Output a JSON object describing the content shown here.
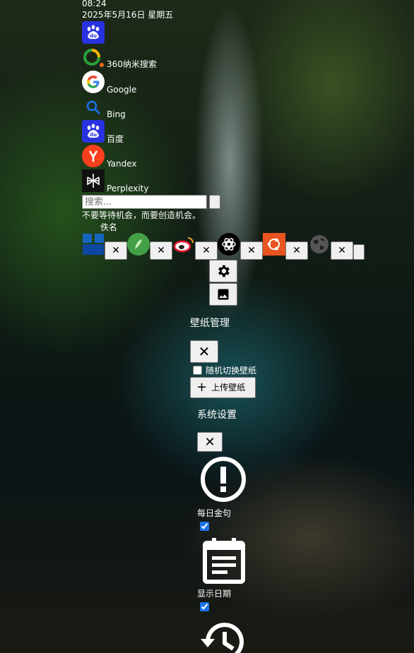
{
  "header": {
    "time": "08:24",
    "date": "2025年5月16日 星期五"
  },
  "engines": [
    {
      "label": ""
    },
    {
      "label": "360纳米搜索"
    },
    {
      "label": "Google"
    },
    {
      "label": "Bing"
    },
    {
      "label": "百度"
    },
    {
      "label": "Yandex"
    },
    {
      "label": "Perplexity"
    }
  ],
  "search": {
    "placeholder": "搜索...",
    "button_label": ""
  },
  "quote": {
    "text": "不要等待机会，而要创造机会。",
    "author": "佚名"
  },
  "shortcuts": {
    "close_glyph": "✕"
  },
  "wallpaper_panel": {
    "title": "壁纸管理",
    "close_glyph": "✕",
    "random_label": "随机切换壁纸",
    "random_checked": false,
    "upload_label": "上传壁纸"
  },
  "settings_panel": {
    "title": "系统设置",
    "close_glyph": "✕",
    "items": [
      {
        "label": "每日金句",
        "checked": true
      },
      {
        "label": "显示日期",
        "checked": true
      }
    ]
  },
  "colors": {
    "baidu_blue": "#2932e1",
    "yandex_red": "#fc3f1d",
    "ubuntu_orange": "#e95420",
    "checkbox_accent": "#1a73e8"
  }
}
